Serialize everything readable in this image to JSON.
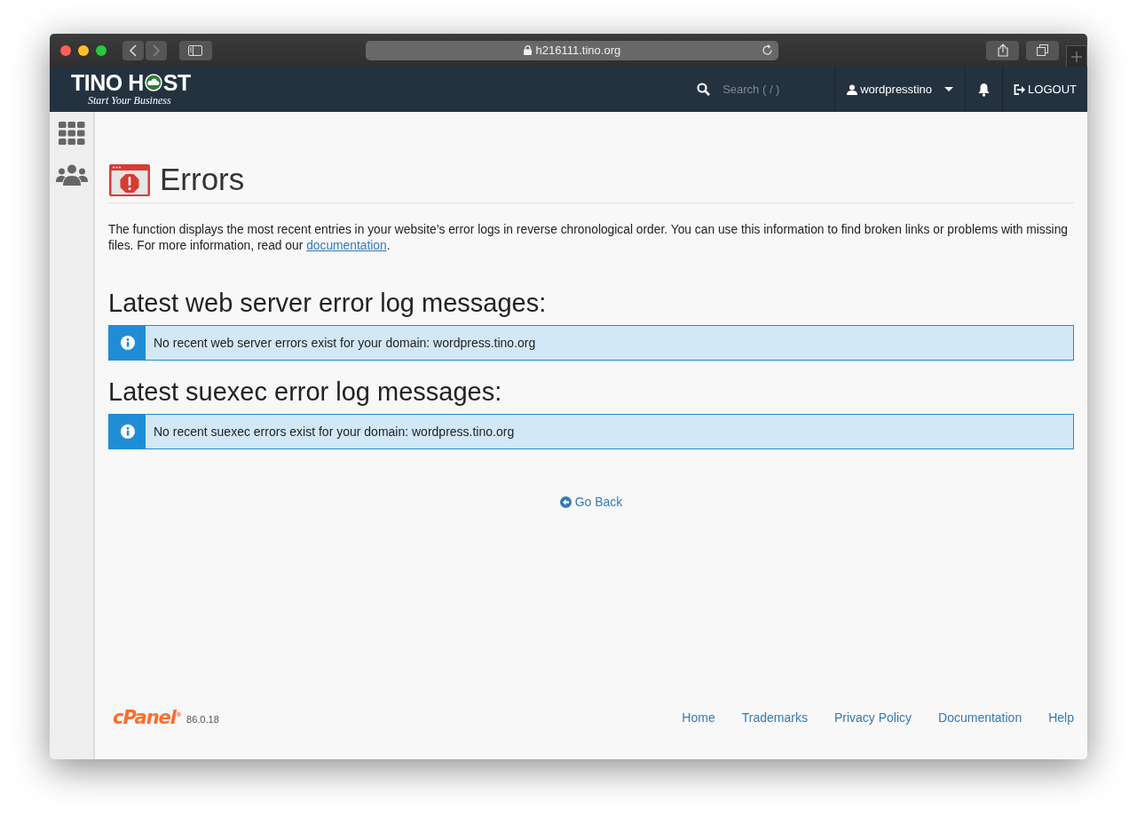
{
  "browser": {
    "url": "h216111.tino.org"
  },
  "header": {
    "logo": {
      "before": "TINO H",
      "after": "ST",
      "tagline": "Start Your Business"
    },
    "search": {
      "placeholder": "Search ( / )"
    },
    "user": "wordpresstino",
    "logout": "LOGOUT"
  },
  "page": {
    "title": "Errors",
    "intro": "The function displays the most recent entries in your website’s error logs in reverse chronological order. You can use this information to find broken links or problems with missing files. For more information, read our ",
    "intro_link": "documentation",
    "intro_end": ".",
    "sections": [
      {
        "heading": "Latest web server error log messages:",
        "message": "No recent web server errors exist for your domain: wordpress.tino.org"
      },
      {
        "heading": "Latest suexec error log messages:",
        "message": "No recent suexec errors exist for your domain: wordpress.tino.org"
      }
    ],
    "back": "Go Back"
  },
  "footer": {
    "brand": "cPanel",
    "brand_mark": "®",
    "version": "86.0.18",
    "links": [
      "Home",
      "Trademarks",
      "Privacy Policy",
      "Documentation",
      "Help"
    ]
  }
}
